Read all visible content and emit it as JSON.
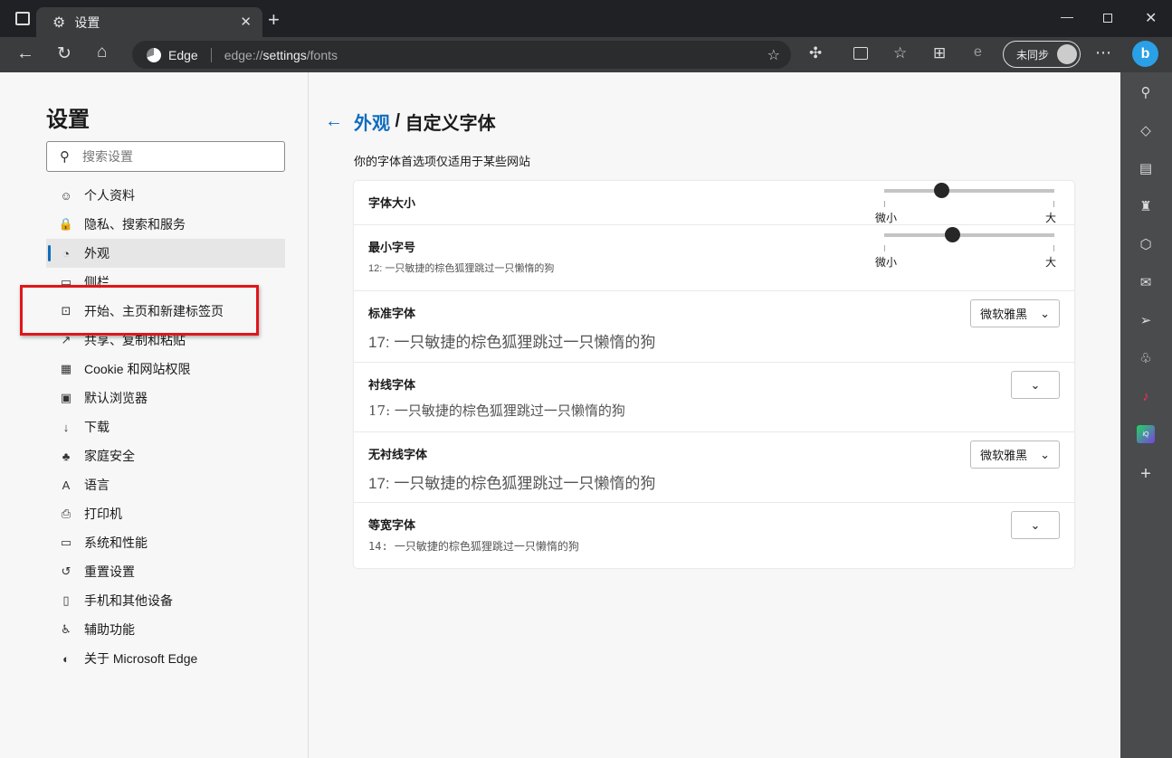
{
  "browser": {
    "tab_title": "设置",
    "addr_brand": "Edge",
    "url_prefix": "edge://",
    "url_main": "settings",
    "url_suffix": "/fonts",
    "sync_label": "未同步"
  },
  "sidebar": {
    "title": "设置",
    "search_placeholder": "搜索设置",
    "items": [
      {
        "label": "个人资料",
        "icon": "profile-icon",
        "glyph": "☺"
      },
      {
        "label": "隐私、搜索和服务",
        "icon": "lock-icon",
        "glyph": "🔒"
      },
      {
        "label": "外观",
        "icon": "palette-icon",
        "glyph": "◔",
        "active": true
      },
      {
        "label": "侧栏",
        "icon": "sidebar-icon",
        "glyph": "▭"
      },
      {
        "label": "开始、主页和新建标签页",
        "icon": "new-tab-icon",
        "glyph": "⊡"
      },
      {
        "label": "共享、复制和粘贴",
        "icon": "share-icon",
        "glyph": "↗"
      },
      {
        "label": "Cookie 和网站权限",
        "icon": "cookie-icon",
        "glyph": "▦"
      },
      {
        "label": "默认浏览器",
        "icon": "browser-icon",
        "glyph": "▣"
      },
      {
        "label": "下载",
        "icon": "download-icon",
        "glyph": "↓"
      },
      {
        "label": "家庭安全",
        "icon": "family-icon",
        "glyph": "♣"
      },
      {
        "label": "语言",
        "icon": "language-icon",
        "glyph": "A"
      },
      {
        "label": "打印机",
        "icon": "printer-icon",
        "glyph": "⎙"
      },
      {
        "label": "系统和性能",
        "icon": "laptop-icon",
        "glyph": "▭"
      },
      {
        "label": "重置设置",
        "icon": "reset-icon",
        "glyph": "↺"
      },
      {
        "label": "手机和其他设备",
        "icon": "phone-icon",
        "glyph": "▯"
      },
      {
        "label": "辅助功能",
        "icon": "accessibility-icon",
        "glyph": "♿"
      },
      {
        "label": "关于 Microsoft Edge",
        "icon": "edge-logo-icon",
        "glyph": "◐"
      }
    ]
  },
  "main": {
    "breadcrumb_parent": "外观",
    "breadcrumb_sep": " / ",
    "breadcrumb_current": "自定义字体",
    "subtitle": "你的字体首选项仅适用于某些网站",
    "font_size": {
      "label": "字体大小",
      "min": "微小",
      "max": "大",
      "value": 0.335
    },
    "min_font_size": {
      "label": "最小字号",
      "sample": "12: 一只敏捷的棕色狐狸跳过一只懒惰的狗",
      "min": "微小",
      "max": "大",
      "value": 0.4
    },
    "standard": {
      "label": "标准字体",
      "sample": "17: 一只敏捷的棕色狐狸跳过一只懒惰的狗",
      "selected": "微软雅黑"
    },
    "serif": {
      "label": "衬线字体",
      "sample": "17: 一只敏捷的棕色狐狸跳过一只懒惰的狗",
      "selected": ""
    },
    "sans": {
      "label": "无衬线字体",
      "sample": "17: 一只敏捷的棕色狐狸跳过一只懒惰的狗",
      "selected": "微软雅黑"
    },
    "mono": {
      "label": "等宽字体",
      "sample": "14: 一只敏捷的棕色狐狸跳过一只懒惰的狗",
      "selected": ""
    }
  },
  "colors": {
    "accent": "#0f6cbd",
    "highlight": "#e0161b"
  }
}
